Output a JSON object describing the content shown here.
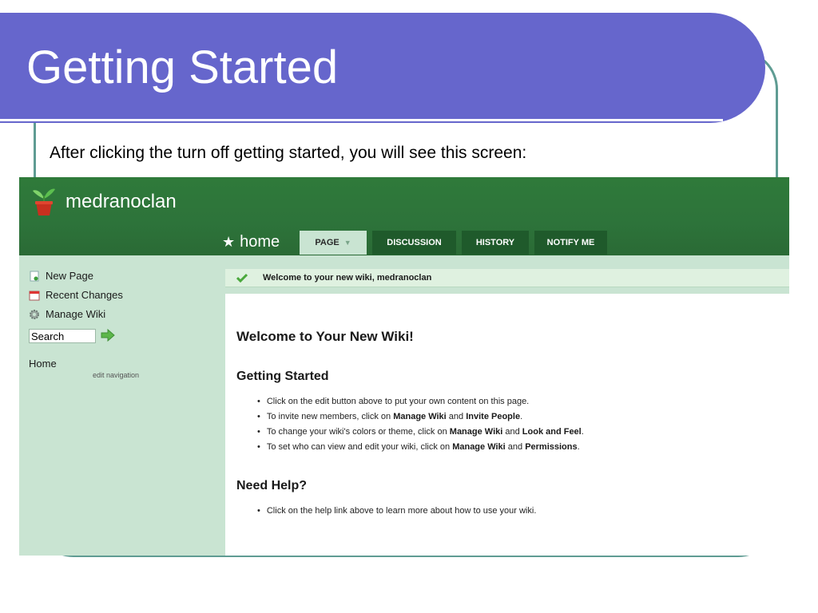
{
  "slide": {
    "title": "Getting Started",
    "subtitle": "After clicking the turn off getting started, you will see this screen:"
  },
  "wiki": {
    "name": "medranoclan",
    "home_label": "home",
    "tabs": [
      "PAGE",
      "DISCUSSION",
      "HISTORY",
      "NOTIFY ME"
    ],
    "sidebar": {
      "items": [
        "New Page",
        "Recent Changes",
        "Manage Wiki"
      ],
      "search_placeholder": "Search",
      "home_link": "Home",
      "edit_navigation": "edit navigation"
    },
    "welcome_message": "Welcome to your new wiki, medranoclan",
    "heading": "Welcome to Your New Wiki!",
    "getting_started": {
      "heading": "Getting Started",
      "items": [
        [
          "Click on the edit button above to put your own content on this page."
        ],
        [
          "To invite new members, click on ",
          "Manage Wiki",
          " and ",
          "Invite People",
          "."
        ],
        [
          "To change your wiki's colors or theme, click on ",
          "Manage Wiki",
          " and ",
          "Look and Feel",
          "."
        ],
        [
          "To set who can view and edit your wiki, click on ",
          "Manage Wiki",
          " and ",
          "Permissions",
          "."
        ]
      ]
    },
    "need_help": {
      "heading": "Need Help?",
      "items": [
        [
          "Click on the help link above to learn more about how to use your wiki."
        ]
      ]
    }
  },
  "colors": {
    "title_bar": "#6666cc",
    "frame": "#5f9c93",
    "wiki_header": "#2f7a3a",
    "tab_dark": "#1f5a2b",
    "sidebar_bg": "#c9e4d2",
    "welcome_bar": "#dff1e0"
  },
  "icons": {
    "logo": "plant-pot-icon",
    "new_page": "new-page-icon",
    "recent_changes": "calendar-icon",
    "manage_wiki": "gear-icon",
    "search_go": "arrow-right-icon",
    "welcome_check": "checkmark-icon",
    "home_star": "star-icon",
    "tab_caret": "caret-down-icon"
  }
}
